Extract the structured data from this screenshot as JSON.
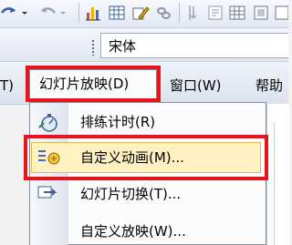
{
  "font": {
    "name": "宋体"
  },
  "menubar": {
    "partial_left": "T)",
    "slideshow": "幻灯片放映(D)",
    "window": "窗口(W)",
    "help": "帮助"
  },
  "dropdown": {
    "items": [
      {
        "label": "排练计时(R)",
        "icon": "stopwatch-icon"
      },
      {
        "label": "自定义动画(M)...",
        "icon": "custom-animation-icon"
      },
      {
        "label": "幻灯片切换(T)...",
        "icon": "slide-transition-icon"
      },
      {
        "label": "自定义放映(W)...",
        "icon": ""
      }
    ]
  },
  "colors": {
    "highlight_border": "#e8131c",
    "hover_fill": "#fff1c1"
  }
}
